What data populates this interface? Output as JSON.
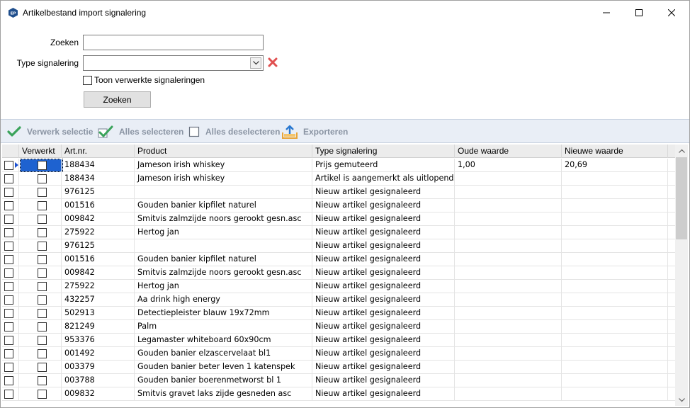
{
  "window": {
    "title": "Artikelbestand import signalering",
    "icon_text": "EP"
  },
  "filters": {
    "search_label": "Zoeken",
    "search_value": "",
    "type_label": "Type signalering",
    "type_value": "",
    "show_processed_label": "Toon verwerkte signaleringen",
    "show_processed_checked": false,
    "search_button": "Zoeken"
  },
  "toolbar": {
    "process_selection": "Verwerk selectie",
    "select_all": "Alles selecteren",
    "deselect_all": "Alles deselecteren",
    "export": "Exporteren"
  },
  "grid": {
    "columns": [
      "",
      "Verwerkt",
      "Art.nr.",
      "Product",
      "Type signalering",
      "Oude waarde",
      "Nieuwe waarde"
    ],
    "rows": [
      {
        "art": "188434",
        "product": "Jameson irish whiskey",
        "type": "Prijs gemuteerd",
        "old": "1,00",
        "new": "20,69"
      },
      {
        "art": "188434",
        "product": "Jameson irish whiskey",
        "type": "Artikel is aangemerkt als uitlopend",
        "old": "",
        "new": ""
      },
      {
        "art": "976125",
        "product": "",
        "type": "Nieuw artikel gesignaleerd",
        "old": "",
        "new": ""
      },
      {
        "art": "001516",
        "product": "Gouden banier kipfilet naturel",
        "type": "Nieuw artikel gesignaleerd",
        "old": "",
        "new": ""
      },
      {
        "art": "009842",
        "product": "Smitvis zalmzijde noors gerookt gesn.asc",
        "type": "Nieuw artikel gesignaleerd",
        "old": "",
        "new": ""
      },
      {
        "art": "275922",
        "product": "Hertog jan",
        "type": "Nieuw artikel gesignaleerd",
        "old": "",
        "new": ""
      },
      {
        "art": "976125",
        "product": "",
        "type": "Nieuw artikel gesignaleerd",
        "old": "",
        "new": ""
      },
      {
        "art": "001516",
        "product": "Gouden banier kipfilet naturel",
        "type": "Nieuw artikel gesignaleerd",
        "old": "",
        "new": ""
      },
      {
        "art": "009842",
        "product": "Smitvis zalmzijde noors gerookt gesn.asc",
        "type": "Nieuw artikel gesignaleerd",
        "old": "",
        "new": ""
      },
      {
        "art": "275922",
        "product": "Hertog jan",
        "type": "Nieuw artikel gesignaleerd",
        "old": "",
        "new": ""
      },
      {
        "art": "432257",
        "product": "Aa drink high energy",
        "type": "Nieuw artikel gesignaleerd",
        "old": "",
        "new": ""
      },
      {
        "art": "502913",
        "product": "Detectiepleister blauw 19x72mm",
        "type": "Nieuw artikel gesignaleerd",
        "old": "",
        "new": ""
      },
      {
        "art": "821249",
        "product": "Palm",
        "type": "Nieuw artikel gesignaleerd",
        "old": "",
        "new": ""
      },
      {
        "art": "953376",
        "product": "Legamaster whiteboard 60x90cm",
        "type": "Nieuw artikel gesignaleerd",
        "old": "",
        "new": ""
      },
      {
        "art": "001492",
        "product": "Gouden banier elzascervelaat bl1",
        "type": "Nieuw artikel gesignaleerd",
        "old": "",
        "new": ""
      },
      {
        "art": "003379",
        "product": "Gouden banier beter leven 1  katenspek",
        "type": "Nieuw artikel gesignaleerd",
        "old": "",
        "new": ""
      },
      {
        "art": "003788",
        "product": "Gouden banier boerenmetworst bl 1",
        "type": "Nieuw artikel gesignaleerd",
        "old": "",
        "new": ""
      },
      {
        "art": "009832",
        "product": "Smitvis gravet laks zijde gesneden asc",
        "type": "Nieuw artikel gesignaleerd",
        "old": "",
        "new": ""
      }
    ]
  },
  "colors": {
    "accent": "#1e62d0",
    "toolbar_bg": "#e9eef6",
    "toolbar_text": "#8a94a3",
    "check_green": "#3aa35b",
    "export_orange": "#e8a53a",
    "clear_red": "#e05050"
  }
}
